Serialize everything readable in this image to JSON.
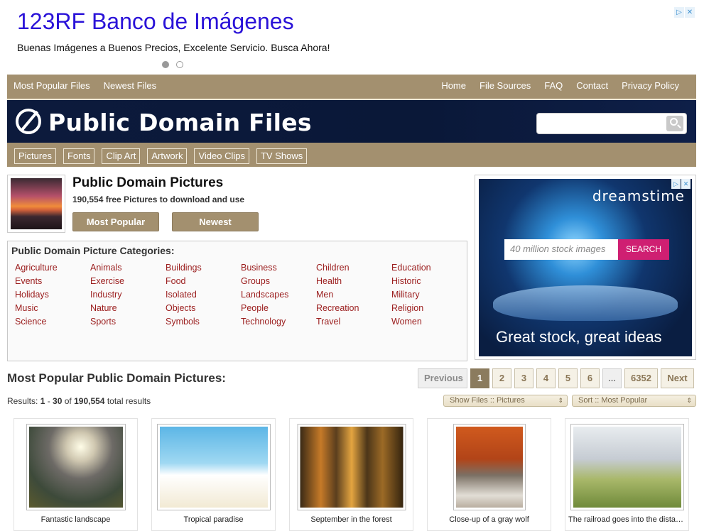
{
  "ad_top": {
    "title": "123RF Banco de Imágenes",
    "subtitle": "Buenas Imágenes a Buenos Precios, Excelente Servicio. Busca Ahora!"
  },
  "topnav": {
    "left": [
      "Most Popular Files",
      "Newest Files"
    ],
    "right": [
      "Home",
      "File Sources",
      "FAQ",
      "Contact",
      "Privacy Policy"
    ]
  },
  "banner": {
    "logo_text": "Public Domain Files",
    "search_value": ""
  },
  "catnav": [
    "Pictures",
    "Fonts",
    "Clip Art",
    "Artwork",
    "Video Clips",
    "TV Shows"
  ],
  "pictures": {
    "title": "Public Domain Pictures",
    "count": "190,554 free Pictures to download and use",
    "btn_popular": "Most Popular",
    "btn_newest": "Newest"
  },
  "categories": {
    "heading": "Public Domain Picture Categories:",
    "items": [
      "Agriculture",
      "Animals",
      "Buildings",
      "Business",
      "Children",
      "Education",
      "Events",
      "Exercise",
      "Food",
      "Groups",
      "Health",
      "Historic",
      "Holidays",
      "Industry",
      "Isolated",
      "Landscapes",
      "Men",
      "Military",
      "Music",
      "Nature",
      "Objects",
      "People",
      "Recreation",
      "Religion",
      "Science",
      "Sports",
      "Symbols",
      "Technology",
      "Travel",
      "Women"
    ]
  },
  "side_ad": {
    "brand": "dreamstime",
    "placeholder": "40 million stock images",
    "search_label": "SEARCH",
    "tagline": "Great stock, great ideas"
  },
  "results": {
    "title": "Most Popular Public Domain Pictures:",
    "prefix": "Results: ",
    "from": "1",
    "dash": " - ",
    "to": "30",
    "of": " of ",
    "total": "190,554",
    "suffix": " total results",
    "pager": {
      "prev": "Previous",
      "pages": [
        "1",
        "2",
        "3",
        "4",
        "5",
        "6"
      ],
      "gap": "...",
      "last": "6352",
      "next": "Next",
      "active": "1"
    },
    "filter_files": "Show Files :: Pictures",
    "filter_sort": "Sort :: Most Popular"
  },
  "cards": [
    {
      "caption": "Fantastic landscape"
    },
    {
      "caption": "Tropical paradise"
    },
    {
      "caption": "September in the forest"
    },
    {
      "caption": "Close-up of a gray wolf"
    },
    {
      "caption": "The railroad goes into the distance"
    }
  ],
  "colors": {
    "nav_bg": "#a3906f",
    "banner_bg": "#0c1a3c",
    "category_link": "#9a1c1c",
    "ad_title": "#2a12d8",
    "search_pink": "#cf1f72"
  }
}
